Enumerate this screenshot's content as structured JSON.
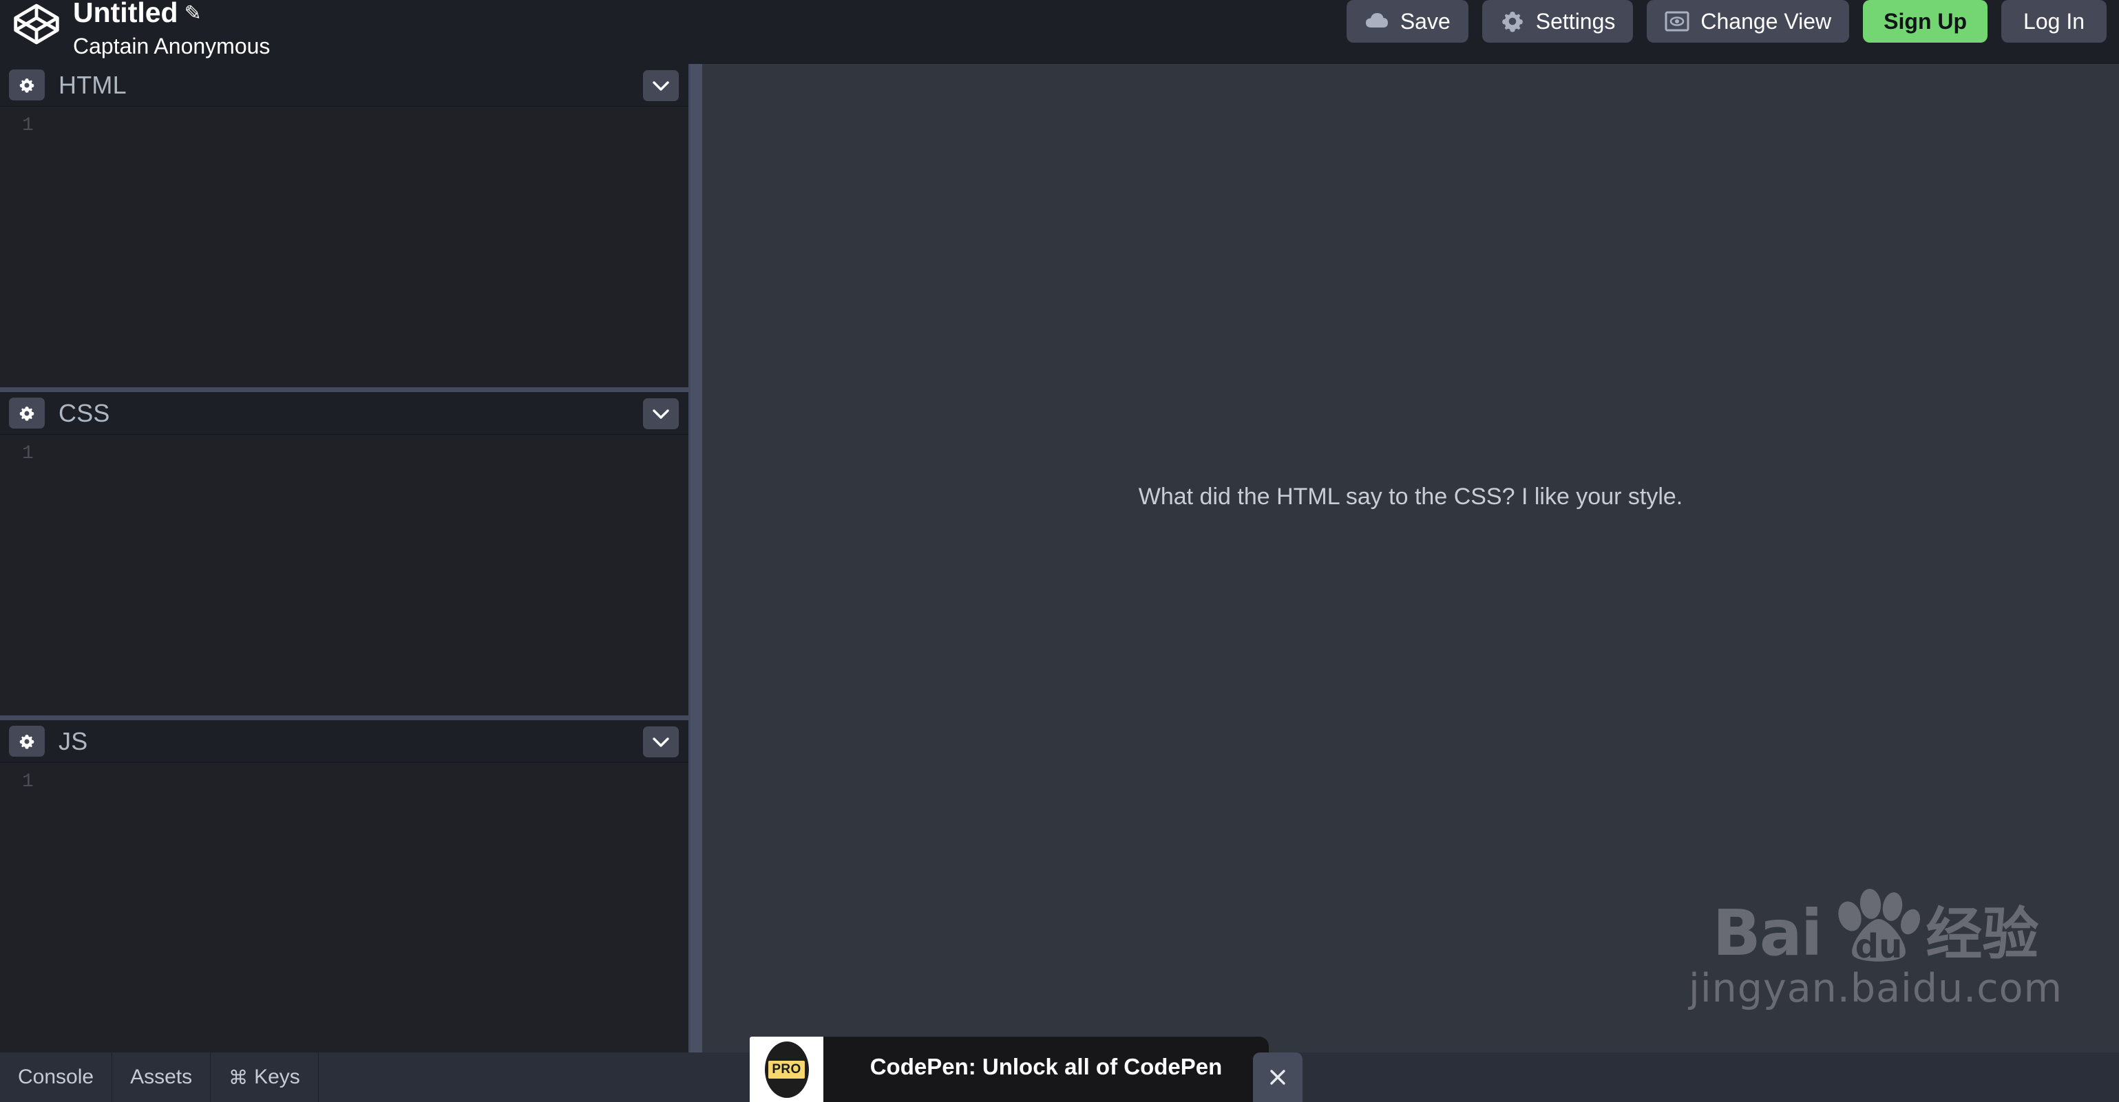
{
  "header": {
    "logo_icon": "codepen-logo-icon",
    "pen_title": "Untitled",
    "edit_glyph": "✎",
    "author": "Captain Anonymous",
    "actions": [
      {
        "id": "save",
        "label": "Save",
        "icon": "cloud-icon"
      },
      {
        "id": "settings",
        "label": "Settings",
        "icon": "gear-icon"
      },
      {
        "id": "change-view",
        "label": "Change View",
        "icon": "eye-screen-icon"
      },
      {
        "id": "signup",
        "label": "Sign Up",
        "icon": ""
      },
      {
        "id": "login",
        "label": "Log In",
        "icon": ""
      }
    ]
  },
  "editors": [
    {
      "id": "html",
      "title": "HTML",
      "gutter_line": "1",
      "code": "",
      "settings_icon": "gear-icon",
      "collapse_icon": "chevron-down-icon"
    },
    {
      "id": "css",
      "title": "CSS",
      "gutter_line": "1",
      "code": "",
      "settings_icon": "gear-icon",
      "collapse_icon": "chevron-down-icon"
    },
    {
      "id": "js",
      "title": "JS",
      "gutter_line": "1",
      "code": "",
      "settings_icon": "gear-icon",
      "collapse_icon": "chevron-down-icon"
    }
  ],
  "preview": {
    "joke_text": "What did the HTML say to the CSS? I like your style.",
    "watermark": {
      "brand_left": "Bai",
      "brand_right": "du",
      "brand_cn": "经验",
      "url": "jingyan.baidu.com",
      "paw_icon": "baidu-paw-icon"
    }
  },
  "bottom_bar": {
    "items": [
      {
        "id": "console",
        "label": "Console",
        "glyph": ""
      },
      {
        "id": "assets",
        "label": "Assets",
        "glyph": ""
      },
      {
        "id": "keys",
        "label": "Keys",
        "glyph": "⌘"
      }
    ]
  },
  "pro_banner": {
    "badge_text": "PRO",
    "message": "CodePen: Unlock all of CodePen",
    "close_icon": "close-icon"
  },
  "colors": {
    "editor_bg": "#1f2127",
    "chrome_bg": "#1d1f26",
    "preview_bg": "#32363f",
    "button_bg": "#444857",
    "accent_green": "#73d673",
    "handle": "#4b5164",
    "bottom_bar_bg": "#2b2f3a",
    "pro_yellow": "#f5d76e"
  }
}
